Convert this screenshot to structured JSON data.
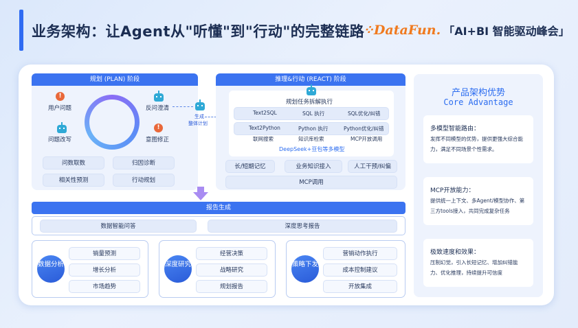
{
  "header": {
    "title": "业务架构：让Agent从\"听懂\"到\"行动\"的完整链路",
    "brand_logo": "DataFun.",
    "brand_event": "「AI+BI 智能驱动峰会」"
  },
  "plan": {
    "head": "规划 (PLAN) 阶段",
    "loop_items": [
      "用户问题",
      "反问澄清",
      "问题改写",
      "意图修正"
    ],
    "chips": [
      "问数取数",
      "归因诊断",
      "相关性预测",
      "行动规划"
    ]
  },
  "connector": {
    "label_line1": "生成",
    "label_line2": "整体计划"
  },
  "react": {
    "head": "推理&行动 (REACT) 阶段",
    "exec_title": "规划任务拆解执行",
    "row1": [
      "Text2SQL",
      "SQL 执行",
      "SQL优化/纠错"
    ],
    "row2": [
      "Text2Python",
      "Python 执行",
      "Python优化/纠错"
    ],
    "row3": [
      "联网搜索",
      "知识库检索",
      "MCP开放调用"
    ],
    "model": "DeepSeek+豆包等多模型",
    "tools": [
      "长/短期记忆",
      "业务知识接入",
      "人工干预/纠偏"
    ],
    "mcp": "MCP调用"
  },
  "report": {
    "head": "报告生成",
    "modes": [
      "数据智能问答",
      "深度思考报告"
    ]
  },
  "groups": [
    {
      "label": "数据分析",
      "items": [
        "销量预测",
        "增长分析",
        "市场趋势"
      ]
    },
    {
      "label": "深度研究",
      "items": [
        "经营决策",
        "战略研究",
        "规划报告"
      ]
    },
    {
      "label": "策略下发",
      "items": [
        "营销动作执行",
        "成本控制建议",
        "开放集成"
      ]
    }
  ],
  "advantage": {
    "title_cn": "产品架构优势",
    "title_en": "Core  Advantage",
    "cards": [
      {
        "heading": "多模型智能路由：",
        "text": "发挥不同模型的优势，提供更强大综合能力，满足不同场景个性需求。"
      },
      {
        "heading": "MCP开放能力：",
        "text": "提供统一上下文、多Agent/模型协作、第三方tools接入，共同完成复杂任务"
      },
      {
        "heading": "极致速度和效果：",
        "text": "压制幻觉，引入长短记忆、增加纠错能力、优化推理，持续提升可信度"
      }
    ]
  }
}
